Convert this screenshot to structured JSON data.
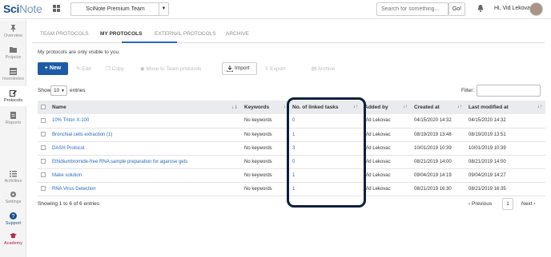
{
  "topbar": {
    "logo_sci": "Sci",
    "logo_note": "Note",
    "team": "SciNote Premium Team",
    "search_placeholder": "Search for something...",
    "go_label": "Go!",
    "user_greeting": "Hi, Vid Lekovac"
  },
  "sidebar": {
    "items": [
      {
        "label": "Overview",
        "icon": "pin-icon"
      },
      {
        "label": "Projects",
        "icon": "folder-icon"
      },
      {
        "label": "Inventories",
        "icon": "inventory-icon"
      },
      {
        "label": "Protocols",
        "icon": "edit-icon"
      },
      {
        "label": "Reports",
        "icon": "report-icon"
      },
      {
        "label": "Activities",
        "icon": "list-icon"
      },
      {
        "label": "Settings",
        "icon": "gear-icon"
      },
      {
        "label": "Support",
        "icon": "help-icon"
      },
      {
        "label": "Academy",
        "icon": "graduation-cap-icon"
      }
    ]
  },
  "tabs": [
    "TEAM PROTOCOLS",
    "MY PROTOCOLS",
    "EXTERNAL PROTOCOLS",
    "ARCHIVE"
  ],
  "notice": "My protocols are only visible to you.",
  "toolbar": {
    "new": "New",
    "edit": "Edit",
    "copy": "Copy",
    "move": "Move to Team protocols",
    "import": "Import",
    "export": "Export",
    "archive": "Archive"
  },
  "list_controls": {
    "show": "Show",
    "page_size": "10",
    "entries": "entries",
    "filter": "Filter:"
  },
  "table": {
    "headers": [
      "Name",
      "Keywords",
      "No. of linked tasks",
      "Added by",
      "Created at",
      "Last modified at"
    ],
    "rows": [
      {
        "name": "10% Triton X-100",
        "keywords": "No keywords",
        "linked": "0",
        "added_by": "Vid Lekovac",
        "created": "04/15/2020 14:32",
        "modified": "04/15/2020 14:32"
      },
      {
        "name": "Bronchial cells extraction (1)",
        "keywords": "No keywords",
        "linked": "1",
        "added_by": "Vid Lekovac",
        "created": "08/19/2019 13:48",
        "modified": "08/19/2019 13:51"
      },
      {
        "name": "DASH Protocol",
        "keywords": "No keywords",
        "linked": "3",
        "added_by": "Vid Lekovac",
        "created": "10/01/2019 10:39",
        "modified": "10/01/2019 10:39"
      },
      {
        "name": "Ethidiumbromide-free RNA sample preparation for agarose gels",
        "keywords": "No keywords",
        "linked": "0",
        "added_by": "Vid Lekovac",
        "created": "08/21/2019 14:00",
        "modified": "08/21/2019 14:00"
      },
      {
        "name": "Make solution",
        "keywords": "No keywords",
        "linked": "1",
        "added_by": "Vid Lekovac",
        "created": "09/04/2019 14:19",
        "modified": "09/04/2019 14:27"
      },
      {
        "name": "RNA Virus Detection",
        "keywords": "No keywords",
        "linked": "1",
        "added_by": "Vid Lekovac",
        "created": "08/21/2019 16:30",
        "modified": "08/21/2019 16:35"
      }
    ]
  },
  "pagination": {
    "info": "Showing 1 to 6 of 6 entries",
    "previous": "Previous",
    "page": "1",
    "next": "Next"
  },
  "colors": {
    "accent": "#1d5ba7",
    "link": "#2a6ab6",
    "highlight_frame": "#0f1f3d"
  }
}
